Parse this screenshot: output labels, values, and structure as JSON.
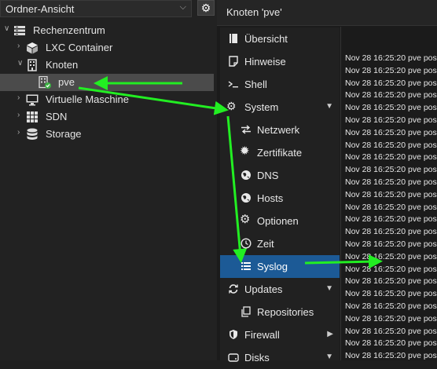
{
  "left_panel": {
    "view_select": {
      "value": "Ordner-Ansicht"
    },
    "tree": [
      {
        "label": "Rechenzentrum",
        "icon": "server-rack-icon"
      },
      {
        "label": "LXC Container",
        "icon": "cube-icon"
      },
      {
        "label": "Knoten",
        "icon": "building-icon"
      },
      {
        "label": "pve",
        "icon": "node-online-icon"
      },
      {
        "label": "Virtuelle Maschine",
        "icon": "monitor-icon"
      },
      {
        "label": "SDN",
        "icon": "grid-icon"
      },
      {
        "label": "Storage",
        "icon": "database-icon"
      }
    ]
  },
  "header": {
    "title": "Knoten 'pve'"
  },
  "nav": [
    {
      "label": "Übersicht",
      "icon": "book-icon"
    },
    {
      "label": "Hinweise",
      "icon": "note-icon"
    },
    {
      "label": "Shell",
      "icon": "terminal-icon"
    },
    {
      "label": "System",
      "icon": "cogs-icon"
    },
    {
      "label": "Netzwerk",
      "icon": "exchange-icon"
    },
    {
      "label": "Zertifikate",
      "icon": "certificate-icon"
    },
    {
      "label": "DNS",
      "icon": "globe-icon"
    },
    {
      "label": "Hosts",
      "icon": "globe-icon"
    },
    {
      "label": "Optionen",
      "icon": "gear-icon"
    },
    {
      "label": "Zeit",
      "icon": "clock-icon"
    },
    {
      "label": "Syslog",
      "icon": "list-icon"
    },
    {
      "label": "Updates",
      "icon": "refresh-icon"
    },
    {
      "label": "Repositories",
      "icon": "copy-icon"
    },
    {
      "label": "Firewall",
      "icon": "shield-icon"
    },
    {
      "label": "Disks",
      "icon": "disk-icon"
    }
  ],
  "log": {
    "line": "Nov 28 16:25:20 pve pos"
  },
  "colors": {
    "selected": "#1c5a96",
    "arrow": "#22ee22"
  }
}
